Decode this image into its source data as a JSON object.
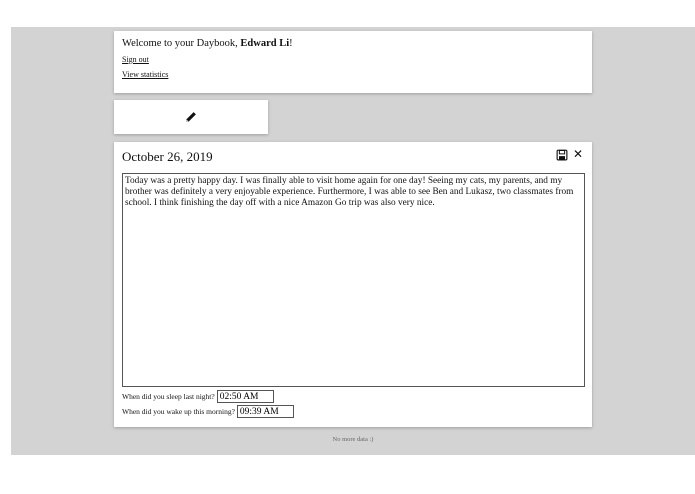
{
  "welcome": {
    "greeting": "Welcome to your Daybook, ",
    "user_name": "Edward Li",
    "punct": "!",
    "sign_out": "Sign out",
    "view_statistics": "View statistics"
  },
  "new_entry": {
    "icon": "pencil-icon"
  },
  "entry": {
    "date": "October 26, 2019",
    "save_icon": "floppy-disk-icon",
    "close_label": "✕",
    "text": "Today was a pretty happy day. I was finally able to visit home again for one day! Seeing my cats, my parents, and my brother was definitely a very enjoyable experience. Furthermore, I was able to see Ben and Lukasz, two classmates from school. I think finishing the day off with a nice Amazon Go trip was also very nice.",
    "sleep_label": "When did you sleep last night?",
    "sleep_value": "02:50 AM",
    "wake_label": "When did you wake up this morning?",
    "wake_value": "09:39 AM"
  },
  "footer": {
    "no_more": "No more data :)"
  }
}
